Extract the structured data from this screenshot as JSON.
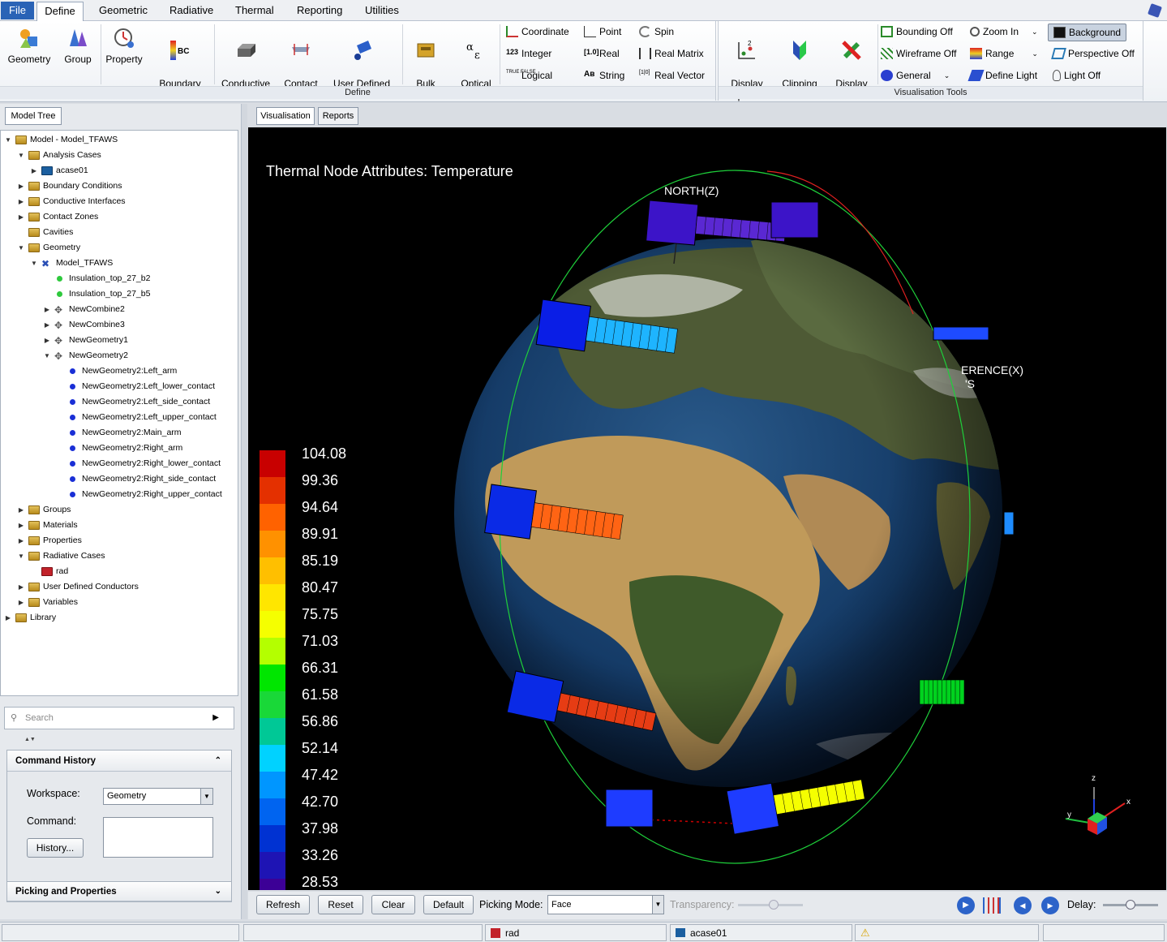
{
  "menu": {
    "items": [
      "File",
      "Define",
      "Geometric",
      "Radiative",
      "Thermal",
      "Reporting",
      "Utilities"
    ]
  },
  "ribbon": {
    "define_group": {
      "label": "Define",
      "big_buttons": [
        "Geometry",
        "Group",
        "Property",
        "Boundary\nCondition",
        "Conductive\nInterface",
        "Contact\nZone",
        "User Defined\nConductor",
        "Bulk\nMaterial",
        "Optical\nSet"
      ],
      "small_buttons": [
        "Coordinate",
        "Integer",
        "Logical",
        "Point",
        "Real",
        "String",
        "Spin",
        "Real Matrix",
        "Real Vector"
      ]
    },
    "vis_group": {
      "label": "Visualisation Tools",
      "big_buttons": [
        "Display\nOptions",
        "Clipping\nPlanes",
        "Display\nData"
      ],
      "small_buttons": [
        "Bounding Off",
        "Wireframe Off",
        "General",
        "Zoom In",
        "Range",
        "Define Light",
        "Background",
        "Perspective Off",
        "Light Off"
      ]
    }
  },
  "left": {
    "tab": "Model Tree",
    "tree": [
      {
        "label": "Model - Model_TFAWS",
        "indent": 0,
        "tw": "▼",
        "icon": "fold"
      },
      {
        "label": "Analysis Cases",
        "indent": 1,
        "tw": "▼",
        "icon": "fold"
      },
      {
        "label": "acase01",
        "indent": 2,
        "tw": "▶",
        "icon": "case"
      },
      {
        "label": "Boundary Conditions",
        "indent": 1,
        "tw": "▶",
        "icon": "fold"
      },
      {
        "label": "Conductive Interfaces",
        "indent": 1,
        "tw": "▶",
        "icon": "fold"
      },
      {
        "label": "Contact Zones",
        "indent": 1,
        "tw": "▶",
        "icon": "fold"
      },
      {
        "label": "Cavities",
        "indent": 1,
        "tw": "",
        "icon": "fold"
      },
      {
        "label": "Geometry",
        "indent": 1,
        "tw": "▼",
        "icon": "fold"
      },
      {
        "label": "Model_TFAWS",
        "indent": 2,
        "tw": "▼",
        "icon": "model"
      },
      {
        "label": "Insulation_top_27_b2",
        "indent": 3,
        "tw": "",
        "icon": "dotg"
      },
      {
        "label": "Insulation_top_27_b5",
        "indent": 3,
        "tw": "",
        "icon": "dotg"
      },
      {
        "label": "NewCombine2",
        "indent": 3,
        "tw": "▶",
        "icon": "geo"
      },
      {
        "label": "NewCombine3",
        "indent": 3,
        "tw": "▶",
        "icon": "geo"
      },
      {
        "label": "NewGeometry1",
        "indent": 3,
        "tw": "▶",
        "icon": "geo"
      },
      {
        "label": "NewGeometry2",
        "indent": 3,
        "tw": "▼",
        "icon": "geo"
      },
      {
        "label": "NewGeometry2:Left_arm",
        "indent": 4,
        "tw": "",
        "icon": "dotb"
      },
      {
        "label": "NewGeometry2:Left_lower_contact",
        "indent": 4,
        "tw": "",
        "icon": "dotb"
      },
      {
        "label": "NewGeometry2:Left_side_contact",
        "indent": 4,
        "tw": "",
        "icon": "dotb"
      },
      {
        "label": "NewGeometry2:Left_upper_contact",
        "indent": 4,
        "tw": "",
        "icon": "dotb"
      },
      {
        "label": "NewGeometry2:Main_arm",
        "indent": 4,
        "tw": "",
        "icon": "dotb"
      },
      {
        "label": "NewGeometry2:Right_arm",
        "indent": 4,
        "tw": "",
        "icon": "dotb"
      },
      {
        "label": "NewGeometry2:Right_lower_contact",
        "indent": 4,
        "tw": "",
        "icon": "dotb"
      },
      {
        "label": "NewGeometry2:Right_side_contact",
        "indent": 4,
        "tw": "",
        "icon": "dotb"
      },
      {
        "label": "NewGeometry2:Right_upper_contact",
        "indent": 4,
        "tw": "",
        "icon": "dotb"
      },
      {
        "label": "Groups",
        "indent": 1,
        "tw": "▶",
        "icon": "fold"
      },
      {
        "label": "Materials",
        "indent": 1,
        "tw": "▶",
        "icon": "fold"
      },
      {
        "label": "Properties",
        "indent": 1,
        "tw": "▶",
        "icon": "fold"
      },
      {
        "label": "Radiative Cases",
        "indent": 1,
        "tw": "▼",
        "icon": "fold"
      },
      {
        "label": "rad",
        "indent": 2,
        "tw": "",
        "icon": "rad"
      },
      {
        "label": "User Defined Conductors",
        "indent": 1,
        "tw": "▶",
        "icon": "fold"
      },
      {
        "label": "Variables",
        "indent": 1,
        "tw": "▶",
        "icon": "fold"
      },
      {
        "label": "Library",
        "indent": 0,
        "tw": "▶",
        "icon": "fold"
      }
    ],
    "search_placeholder": "Search",
    "command_history": {
      "title": "Command History",
      "workspace_label": "Workspace:",
      "workspace_value": "Geometry",
      "command_label": "Command:",
      "history_button": "History..."
    },
    "picking_title": "Picking and Properties"
  },
  "vis": {
    "tabs": [
      "Visualisation",
      "Reports"
    ],
    "title": "Thermal Node Attributes: Temperature",
    "north_label": "NORTH(Z)",
    "ref_label_1": "ERENCE(X)",
    "ref_label_2": "'S",
    "axis_labels": {
      "x": "x",
      "y": "y",
      "z": "z"
    },
    "legend_values": [
      "104.08",
      "99.36",
      "94.64",
      "89.91",
      "85.19",
      "80.47",
      "75.75",
      "71.03",
      "66.31",
      "61.58",
      "56.86",
      "52.14",
      "47.42",
      "42.70",
      "37.98",
      "33.26",
      "28.53"
    ],
    "legend_colors": [
      "#c80000",
      "#e43000",
      "#ff6200",
      "#ff9100",
      "#ffbf00",
      "#ffe600",
      "#f5ff00",
      "#b4ff00",
      "#00e600",
      "#19d838",
      "#00c896",
      "#00d2ff",
      "#0096ff",
      "#0064f0",
      "#0032d2",
      "#1e14b4",
      "#3c0096"
    ],
    "satellites": [
      {
        "color": "#3c14c8",
        "panel": "#5a28d2"
      },
      {
        "color": "#0a1ee6",
        "panel": "#1eb4ff"
      },
      {
        "color": "#0a2ae6",
        "panel": "#ff6414"
      },
      {
        "color": "#0a2ae6",
        "panel": "#e63c14"
      },
      {
        "color": "#1e3cff",
        "panel": "#f5ff00"
      },
      {
        "color": "#1450ff",
        "panel": "#00d21e"
      }
    ]
  },
  "bottom": {
    "buttons": [
      "Refresh",
      "Reset",
      "Clear",
      "Default"
    ],
    "picking_label": "Picking Mode:",
    "picking_value": "Face",
    "transparency_label": "Transparency:",
    "delay_label": "Delay:",
    "transparency_level": 0.55,
    "delay_level": 0.5
  },
  "status": {
    "rad": "rad",
    "acase": "acase01"
  }
}
